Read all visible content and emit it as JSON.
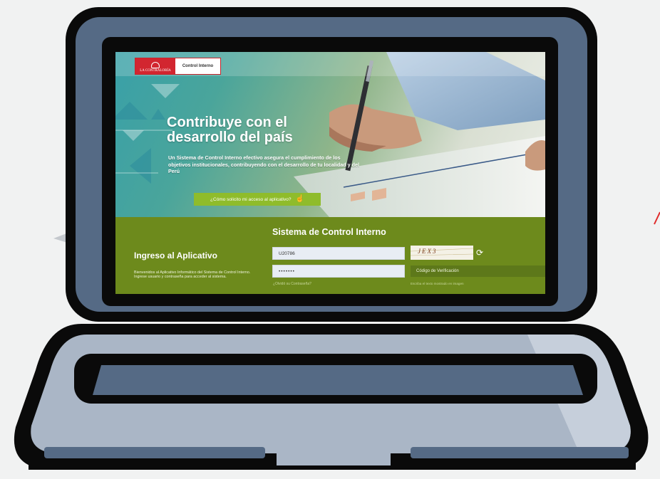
{
  "colors": {
    "laptop_frame": "#0a0a0a",
    "laptop_body": "#556a85",
    "laptop_base": "#aab6c6",
    "panel_green": "#6d8a1c",
    "button_green": "#8fbc2b",
    "brand_red": "#d22630"
  },
  "header": {
    "logo_text": "LA CONTRALORÍA",
    "section_label": "Control Interno"
  },
  "hero": {
    "title": "Contribuye con el desarrollo del país",
    "description": "Un Sistema de Control Interno efectivo asegura el cumplimiento de los objetivos institucionales, contribuyendo con el desarrollo de tu localidad y del Perú",
    "access_button": "¿Cómo solicito mi acceso al aplicativo?",
    "access_icon": "cursor-click-icon"
  },
  "login": {
    "system_title": "Sistema de Control Interno",
    "heading": "Ingreso al Aplicativo",
    "description": "Bienvenidos al Aplicativo Informático del Sistema de Control Interno. Ingrese usuario y contraseña para acceder al sistema.",
    "username_value": "U20786",
    "password_value": "•••••••",
    "forgot_link": "¿Olvidó su Contraseña?",
    "captcha_text": "JEX3",
    "refresh_icon": "refresh-icon",
    "verification_label": "Código de Verificación",
    "verification_hint": "Escriba el texto mostrado en imagen"
  }
}
